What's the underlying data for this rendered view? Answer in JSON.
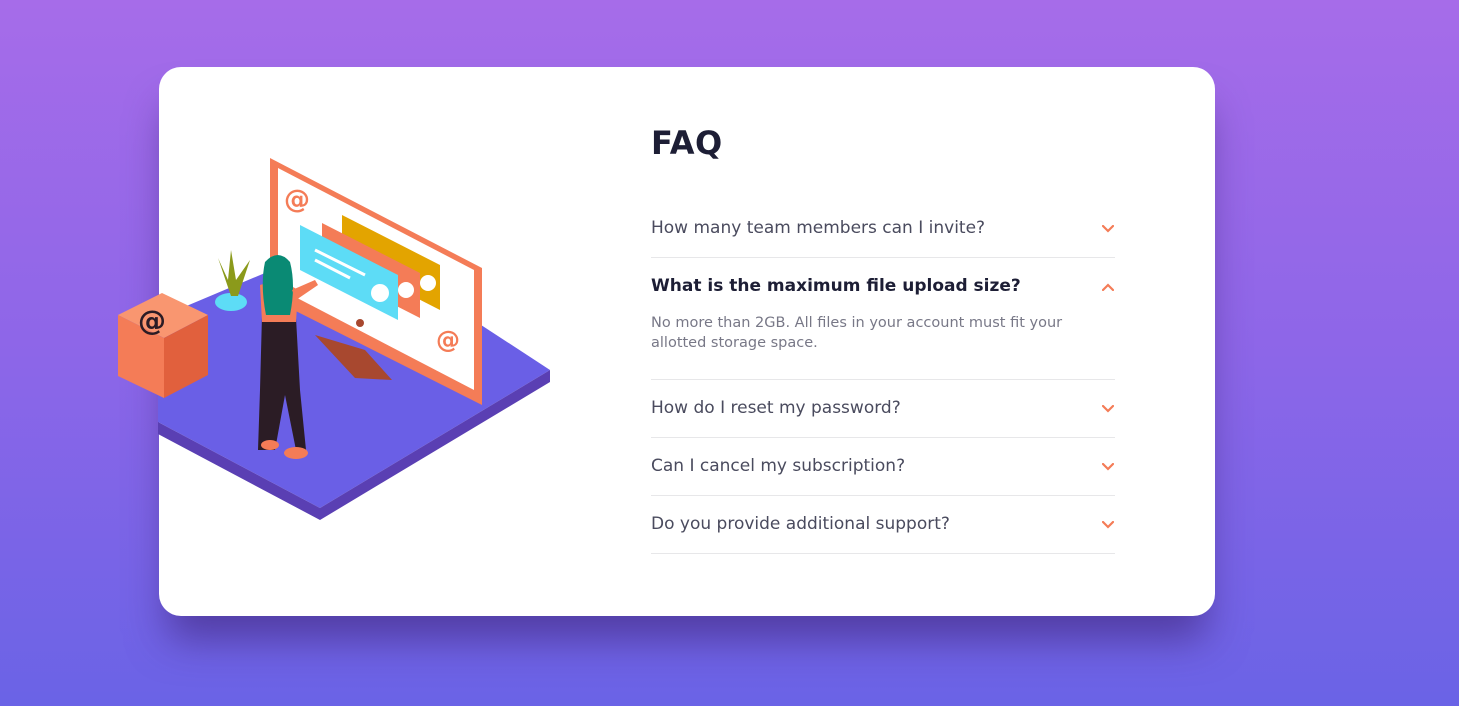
{
  "faq": {
    "title": "FAQ",
    "items": [
      {
        "question": "How many team members can I invite?",
        "answer": "",
        "expanded": false
      },
      {
        "question": "What is the maximum file upload size?",
        "answer": "No more than 2GB. All files in your account must fit your allotted storage space.",
        "expanded": true
      },
      {
        "question": "How do I reset my password?",
        "answer": "",
        "expanded": false
      },
      {
        "question": "Can I cancel my subscription?",
        "answer": "",
        "expanded": false
      },
      {
        "question": "Do you provide additional support?",
        "answer": "",
        "expanded": false
      }
    ]
  },
  "icons": {
    "chevron_down": "chevron-down-icon",
    "chevron_up": "chevron-up-icon"
  },
  "colors": {
    "accent": "#f47c57",
    "title": "#1d1e35",
    "question": "#4a4b5e",
    "answer": "#787887",
    "divider": "#e7e7e9",
    "card": "#ffffff",
    "bg_top": "#a66ce9",
    "bg_bottom": "#6a63e6"
  }
}
